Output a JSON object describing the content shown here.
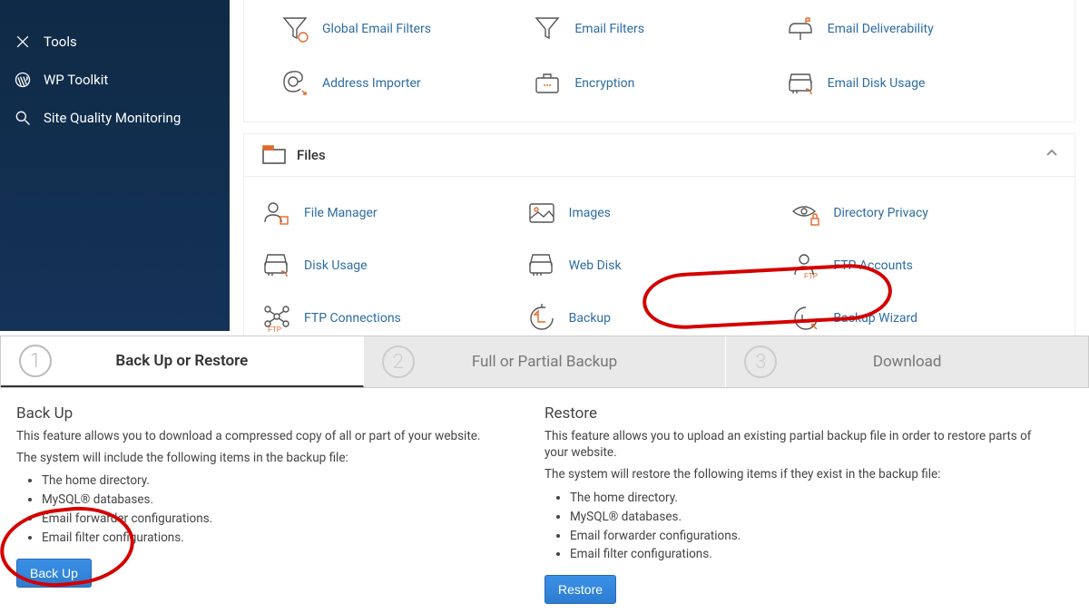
{
  "sidebar": {
    "items": [
      {
        "label": "Tools"
      },
      {
        "label": "WP Toolkit"
      },
      {
        "label": "Site Quality Monitoring"
      }
    ]
  },
  "email": {
    "items": [
      {
        "label": "Global Email Filters"
      },
      {
        "label": "Email Filters"
      },
      {
        "label": "Email Deliverability"
      },
      {
        "label": "Address Importer"
      },
      {
        "label": "Encryption"
      },
      {
        "label": "Email Disk Usage"
      }
    ]
  },
  "files": {
    "title": "Files",
    "items": [
      {
        "label": "File Manager"
      },
      {
        "label": "Images"
      },
      {
        "label": "Directory Privacy"
      },
      {
        "label": "Disk Usage"
      },
      {
        "label": "Web Disk"
      },
      {
        "label": "FTP Accounts"
      },
      {
        "label": "FTP Connections"
      },
      {
        "label": "Backup"
      },
      {
        "label": "Backup Wizard"
      }
    ]
  },
  "wizard": {
    "steps": [
      {
        "num": "1",
        "label": "Back Up or Restore"
      },
      {
        "num": "2",
        "label": "Full or Partial Backup"
      },
      {
        "num": "3",
        "label": "Download"
      }
    ]
  },
  "backup": {
    "title": "Back Up",
    "desc": "This feature allows you to download a compressed copy of all or part of your website.",
    "note": "The system will include the following items in the backup file:",
    "items": [
      "The home directory.",
      "MySQL® databases.",
      "Email forwarder configurations.",
      "Email filter configurations."
    ],
    "button": "Back Up"
  },
  "restore": {
    "title": "Restore",
    "desc": "This feature allows you to upload an existing partial backup file in order to restore parts of your website.",
    "note": "The system will restore the following items if they exist in the backup file:",
    "items": [
      "The home directory.",
      "MySQL® databases.",
      "Email forwarder configurations.",
      "Email filter configurations."
    ],
    "button": "Restore"
  }
}
